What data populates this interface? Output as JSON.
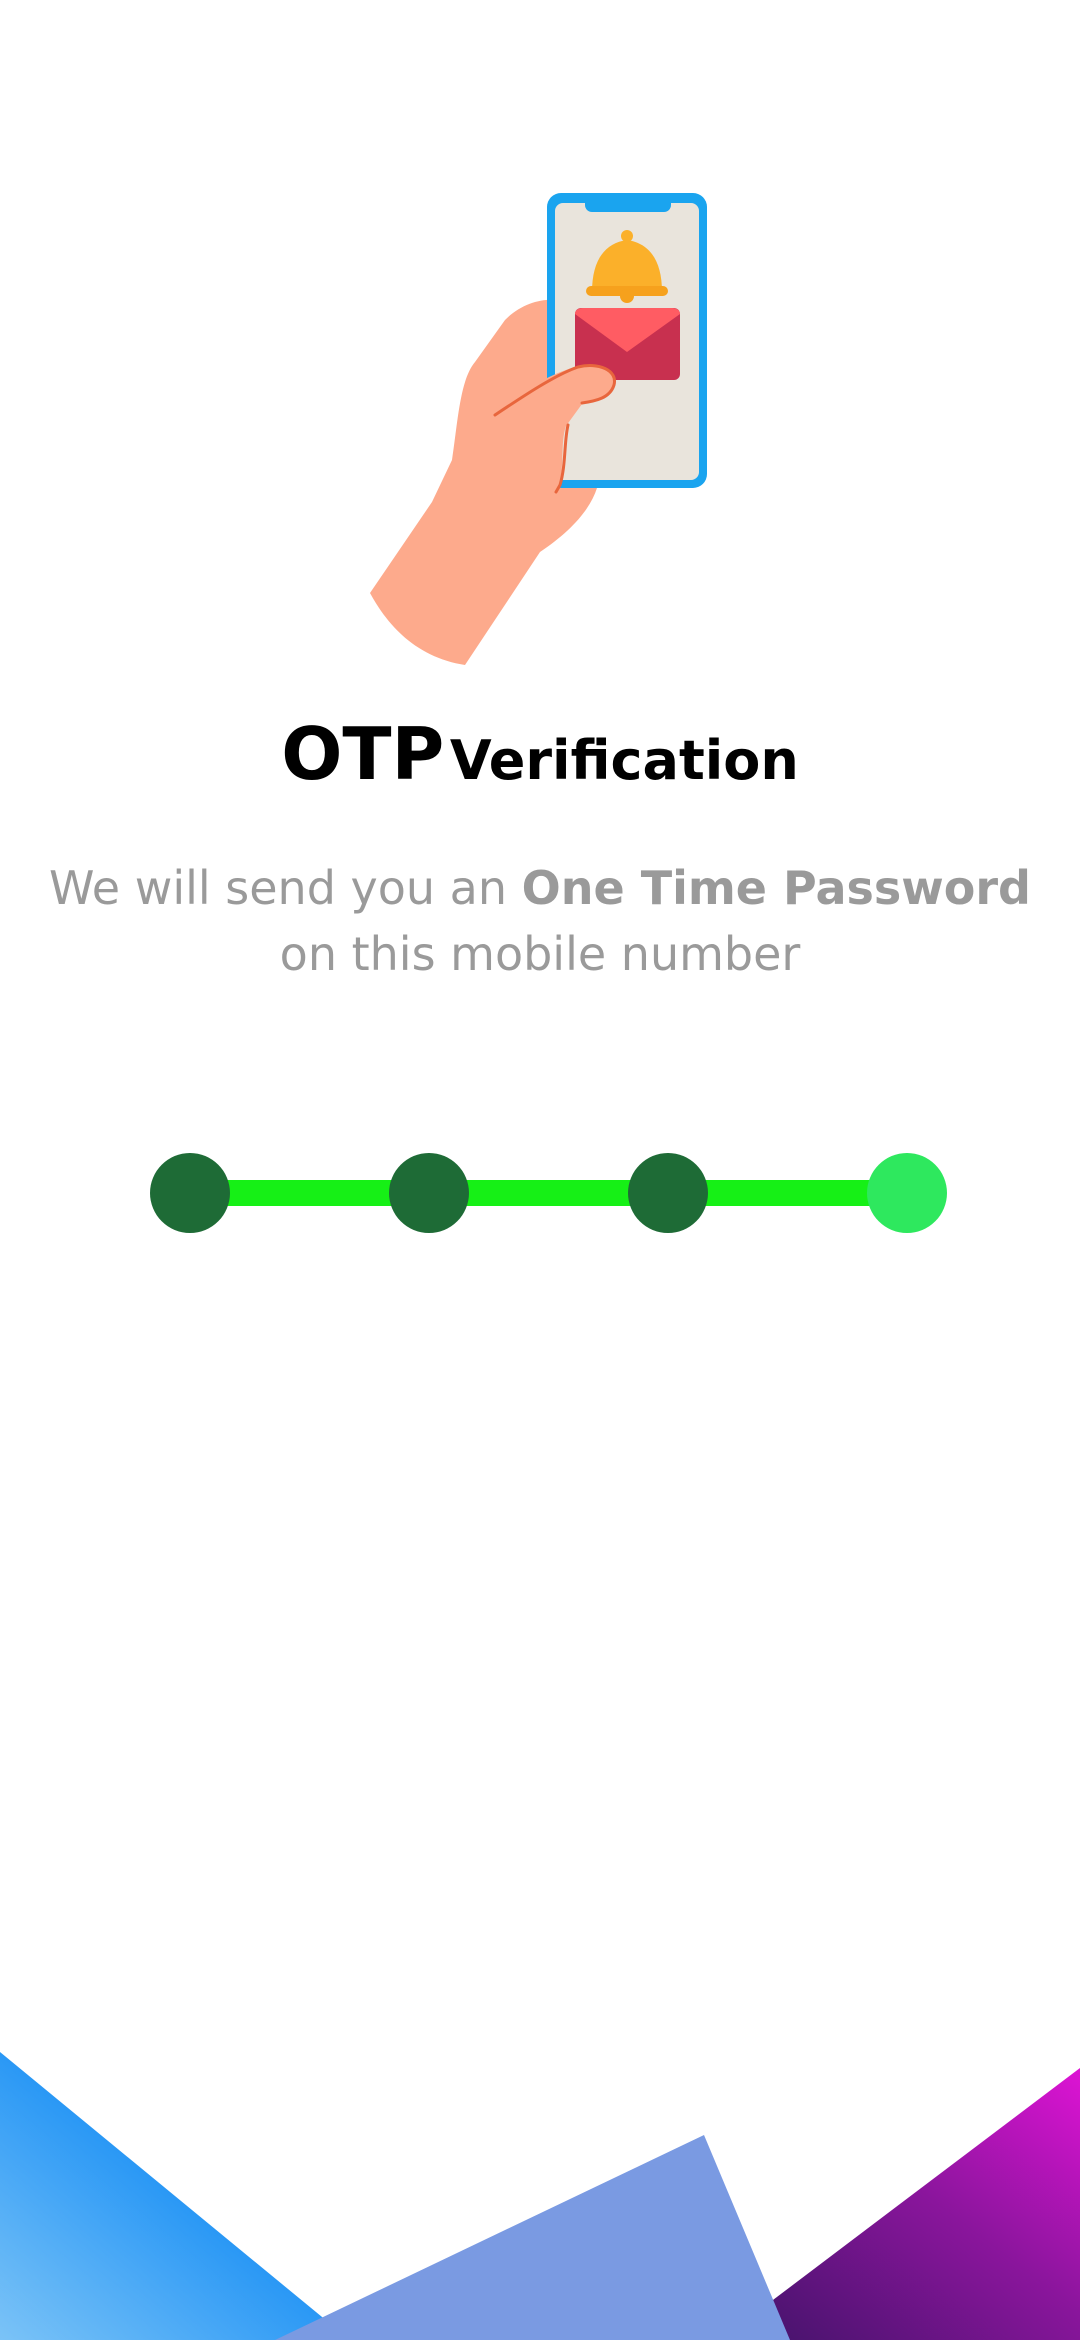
{
  "title": {
    "part1": "OTP",
    "part2": "Verification"
  },
  "subtitle": {
    "line1_prefix": "We will send you an ",
    "line1_bold": "One Time Password",
    "line2": "on this mobile number"
  },
  "steps": {
    "total": 4,
    "completed": 3,
    "current": 4
  },
  "colors": {
    "step_completed": "#1e6b36",
    "step_current": "#2ee85e",
    "step_line": "#16f016",
    "subtitle_text": "#9a9a9a"
  },
  "icons": {
    "illustration": "hand-holding-phone-with-bell-and-envelope"
  }
}
